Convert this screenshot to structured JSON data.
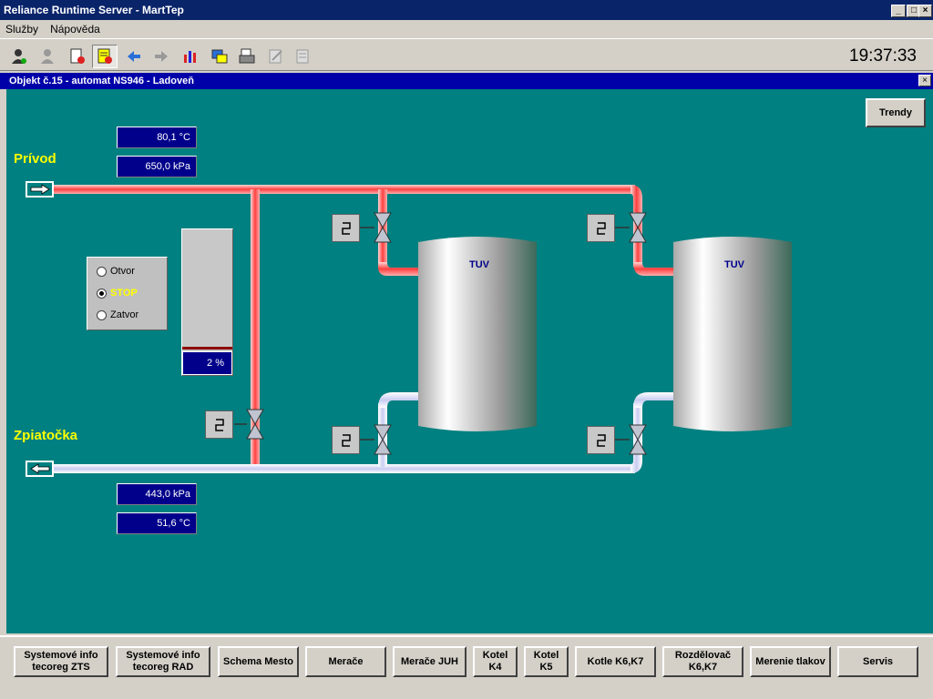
{
  "window": {
    "title": "Reliance Runtime Server - MartTep"
  },
  "menu": [
    {
      "label": "Služby"
    },
    {
      "label": "Nápověda"
    }
  ],
  "toolbar": {
    "clock": "19:37:33"
  },
  "child": {
    "title": "Objekt č.15 - automat NS946 - Ladoveň"
  },
  "scheme": {
    "supply_label": "Prívod",
    "return_label": "Zpiatočka",
    "supply_temp": "80,1 °C",
    "supply_pressure": "650,0 kPa",
    "return_pressure": "443,0 kPa",
    "return_temp": "51,6 °C",
    "valve_percent": "2 %",
    "valve_fraction": 0.02,
    "tank1_label": "TUV",
    "tank2_label": "TUV",
    "trend_button": "Trendy",
    "valve_control": {
      "options": [
        {
          "label": "Otvor",
          "selected": false
        },
        {
          "label": "STOP",
          "selected": true
        },
        {
          "label": "Zatvor",
          "selected": false
        }
      ]
    }
  },
  "nav_buttons": [
    {
      "line1": "Systemové info",
      "line2": "tecoreg ZTS"
    },
    {
      "line1": "Systemové info",
      "line2": "tecoreg RAD"
    },
    {
      "line1": "Schema Mesto",
      "line2": ""
    },
    {
      "line1": "Merače",
      "line2": ""
    },
    {
      "line1": "Merače JUH",
      "line2": ""
    },
    {
      "line1": "Kotel",
      "line2": "K4"
    },
    {
      "line1": "Kotel",
      "line2": "K5"
    },
    {
      "line1": "Kotle K6,K7",
      "line2": ""
    },
    {
      "line1": "Rozdělovač",
      "line2": "K6,K7"
    },
    {
      "line1": "Merenie tlakov",
      "line2": ""
    },
    {
      "line1": "Servis",
      "line2": ""
    }
  ],
  "colors": {
    "background": "#008080",
    "value_box": "#00008b",
    "label": "#ffff00",
    "hot_pipe": "#ff5a5a",
    "cold_pipe": "#e8ecff"
  }
}
